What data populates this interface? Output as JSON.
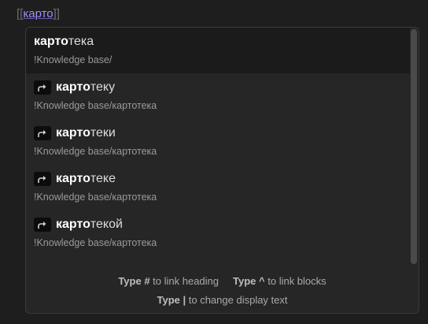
{
  "editor": {
    "open_brackets": "[[",
    "typed_query": "карто",
    "close_brackets": "]]"
  },
  "suggestions": [
    {
      "match": "карто",
      "rest": "тека",
      "path": "!Knowledge base/",
      "alias": false,
      "selected": true
    },
    {
      "match": "карто",
      "rest": "теку",
      "path": "!Knowledge base/картотека",
      "alias": true,
      "selected": false
    },
    {
      "match": "карто",
      "rest": "теки",
      "path": "!Knowledge base/картотека",
      "alias": true,
      "selected": false
    },
    {
      "match": "карто",
      "rest": "теке",
      "path": "!Knowledge base/картотека",
      "alias": true,
      "selected": false
    },
    {
      "match": "карто",
      "rest": "текой",
      "path": "!Knowledge base/картотека",
      "alias": true,
      "selected": false
    }
  ],
  "icons": {
    "alias": "alias-arrow-icon"
  },
  "instructions": [
    {
      "command": "Type #",
      "purpose": "to link heading"
    },
    {
      "command": "Type ^",
      "purpose": "to link blocks"
    },
    {
      "command": "Type |",
      "purpose": "to change display text"
    }
  ],
  "colors": {
    "background": "#1e1e1e",
    "popover": "#262626",
    "selected_row": "#1b1b1b",
    "link_accent": "#a68af9"
  }
}
